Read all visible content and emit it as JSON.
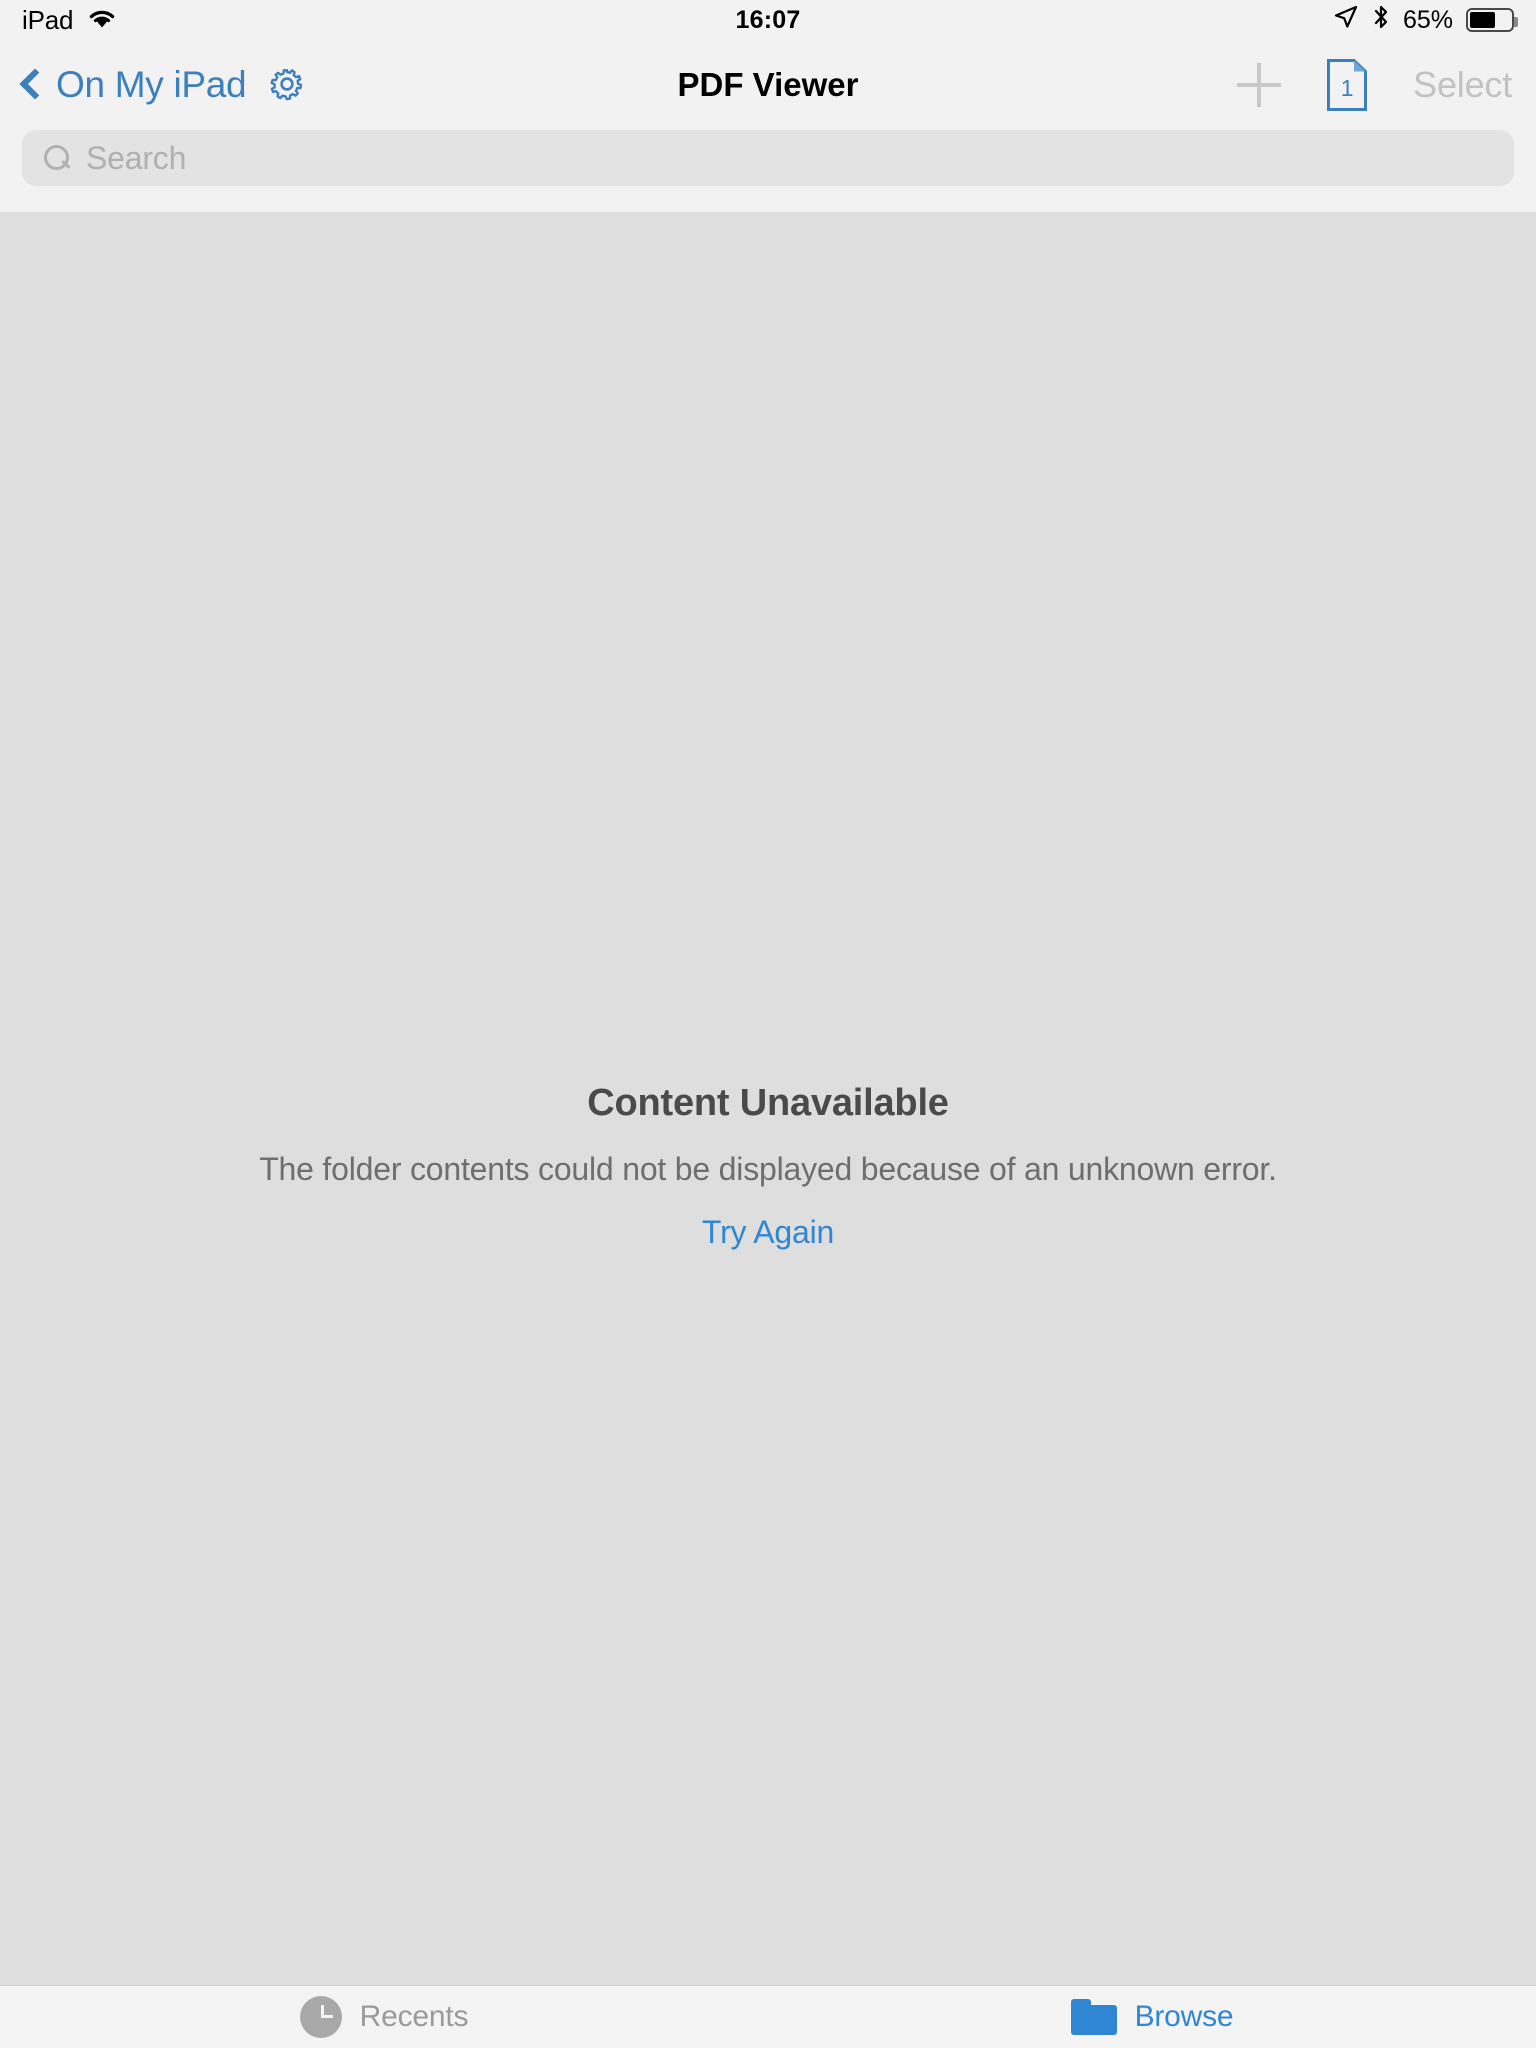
{
  "status_bar": {
    "device_label": "iPad",
    "wifi_icon": "wifi-icon",
    "time": "16:07",
    "location_icon": "location-arrow-icon",
    "bluetooth_icon": "bluetooth-icon",
    "battery_percent_label": "65%",
    "battery_level": 62
  },
  "nav_bar": {
    "back_label": "On My iPad",
    "settings_icon": "gear-icon",
    "title": "PDF Viewer",
    "add_icon": "plus-icon",
    "document_badge_count": "1",
    "select_label": "Select"
  },
  "search": {
    "placeholder": "Search",
    "value": "",
    "icon": "search-icon"
  },
  "content": {
    "empty_title": "Content Unavailable",
    "empty_message": "The folder contents could not be displayed because of an unknown error.",
    "retry_label": "Try Again"
  },
  "tab_bar": {
    "tabs": [
      {
        "label": "Recents",
        "icon": "clock-icon",
        "active": false
      },
      {
        "label": "Browse",
        "icon": "folder-icon",
        "active": true
      }
    ]
  },
  "colors": {
    "accent_blue": "#2f86d3",
    "nav_blue": "#3b7fbd",
    "disabled_grey": "#c2c2c2",
    "content_bg": "#dedede",
    "chrome_bg": "#f2f2f2"
  }
}
